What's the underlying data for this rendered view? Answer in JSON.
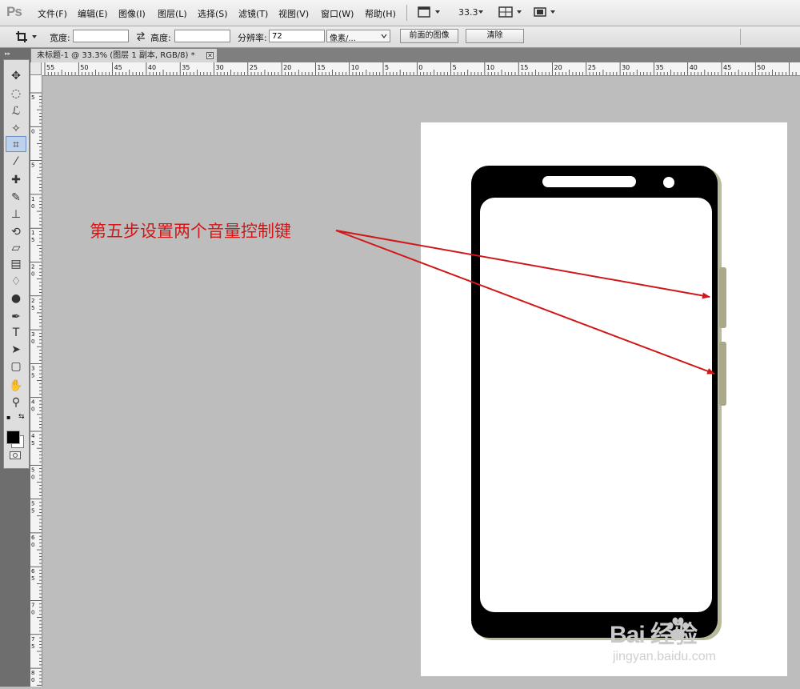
{
  "app": {
    "logo": "Ps"
  },
  "menubar": {
    "items": [
      "文件(F)",
      "编辑(E)",
      "图像(I)",
      "图层(L)",
      "选择(S)",
      "滤镜(T)",
      "视图(V)",
      "窗口(W)",
      "帮助(H)"
    ],
    "zoom": "33.3"
  },
  "options": {
    "width_label": "宽度:",
    "width_value": "",
    "height_label": "高度:",
    "height_value": "",
    "resolution_label": "分辨率:",
    "resolution_value": "72",
    "unit": "像素/...",
    "front_image_button": "前面的图像",
    "clear_button": "清除"
  },
  "document": {
    "tab_title": "未标题-1 @ 33.3% (图层 1 副本, RGB/8) *",
    "close_glyph": "✕"
  },
  "ruler": {
    "top_labels": [
      "55",
      "50",
      "45",
      "40",
      "35",
      "30",
      "25",
      "20",
      "15",
      "10",
      "5",
      "0",
      "5",
      "10",
      "15",
      "20",
      "25",
      "30",
      "35",
      "40",
      "45",
      "50"
    ],
    "left_labels": [
      "5",
      "0",
      "5",
      "1 0",
      "1 5",
      "2 0",
      "2 5",
      "3 0",
      "3 5",
      "4 0",
      "4 5",
      "5 0",
      "5 5",
      "6 0",
      "6 5",
      "7 0",
      "7 5",
      "8 0"
    ]
  },
  "canvas": {
    "annotation": "第五步设置两个音量控制键",
    "annotation_color": "#d01818",
    "phone_body_color": "#000000",
    "button_color": "#a9a98a"
  },
  "watermark": {
    "brand": "Bai  经验",
    "url": "jingyan.baidu.com"
  },
  "tools": [
    "move-icon",
    "marquee-icon",
    "lasso-icon",
    "quick-select-icon",
    "crop-icon",
    "eyedropper-icon",
    "healing-brush-icon",
    "brush-icon",
    "clone-stamp-icon",
    "history-brush-icon",
    "eraser-icon",
    "gradient-icon",
    "blur-icon",
    "dodge-icon",
    "pen-icon",
    "type-icon",
    "path-select-icon",
    "shape-icon",
    "hand-icon",
    "zoom-icon"
  ]
}
